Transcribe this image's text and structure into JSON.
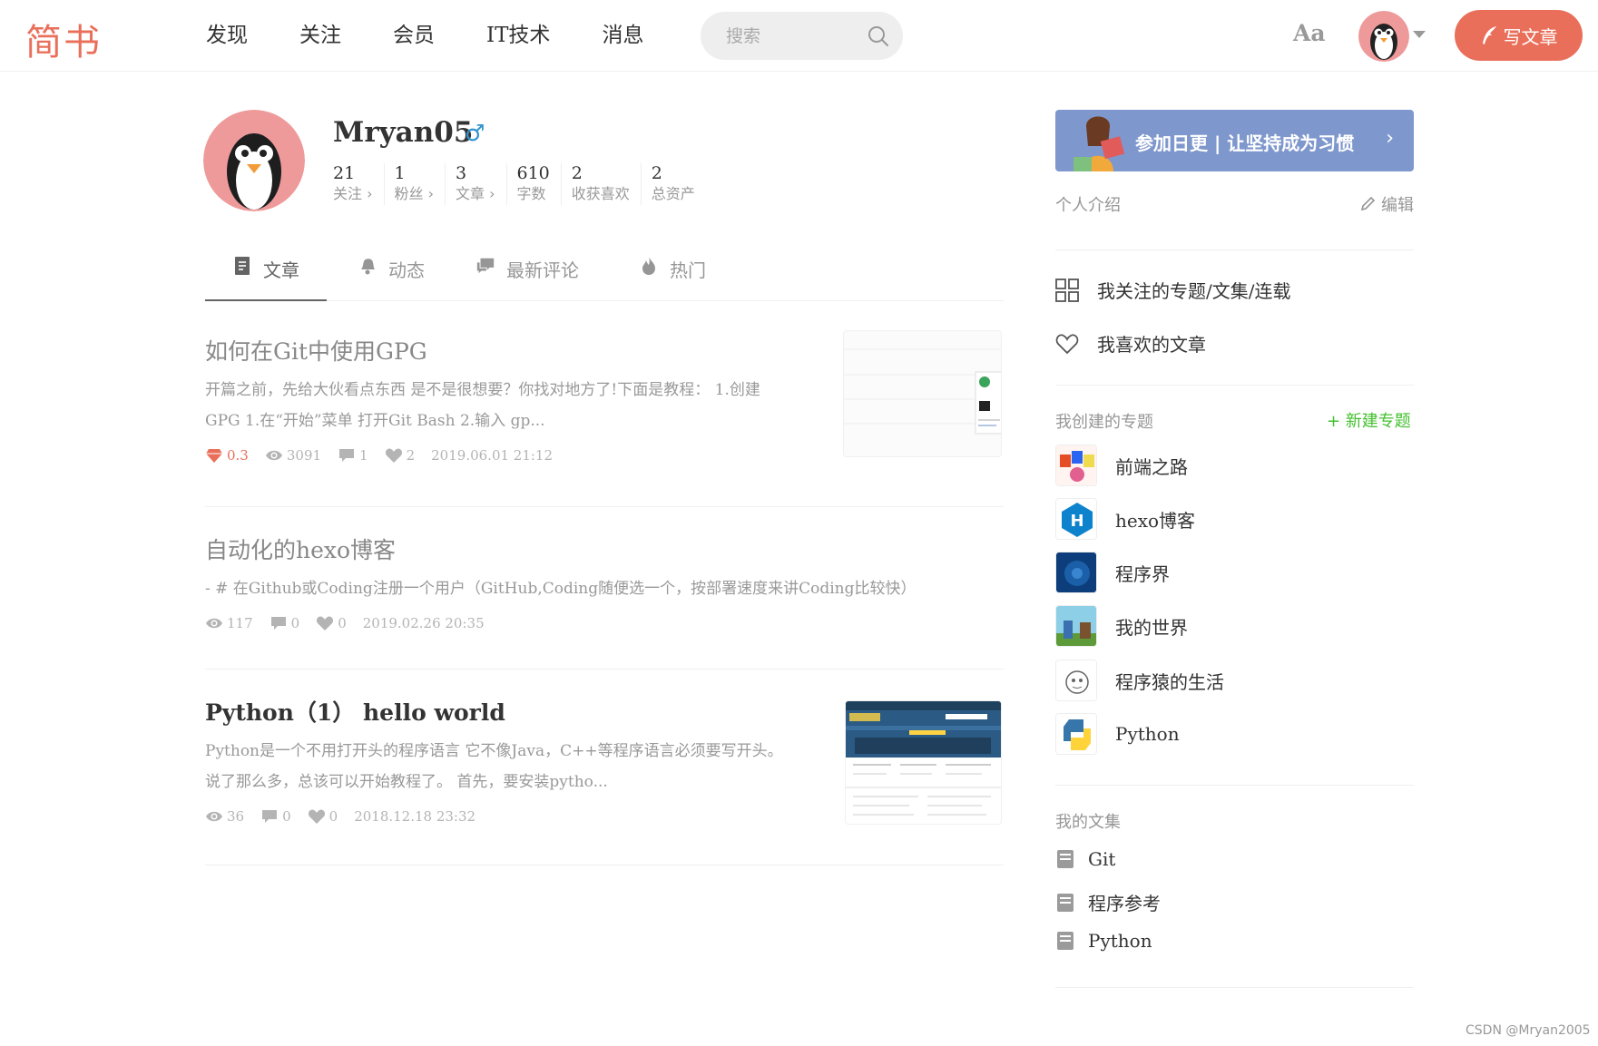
{
  "nav": {
    "logo": "简书",
    "links": [
      "发现",
      "关注",
      "会员",
      "IT技术",
      "消息"
    ],
    "search_placeholder": "搜索",
    "font_toggle": "Aa",
    "write_label": "写文章",
    "accent_color": "#ea6f5a"
  },
  "profile": {
    "username": "Mryan05",
    "gender_symbol": "♂",
    "stats": [
      {
        "value": "21",
        "label": "关注 ›"
      },
      {
        "value": "1",
        "label": "粉丝 ›"
      },
      {
        "value": "3",
        "label": "文章 ›"
      },
      {
        "value": "610",
        "label": "字数"
      },
      {
        "value": "2",
        "label": "收获喜欢"
      },
      {
        "value": "2",
        "label": "总资产"
      }
    ]
  },
  "tabs": [
    {
      "label": "文章",
      "icon": "document-icon",
      "active": true
    },
    {
      "label": "动态",
      "icon": "bell-icon",
      "active": false
    },
    {
      "label": "最新评论",
      "icon": "comment-icon",
      "active": false
    },
    {
      "label": "热门",
      "icon": "fire-icon",
      "active": false
    }
  ],
  "articles": [
    {
      "title": "如何在Git中使用GPG",
      "abstract_line1": "开篇之前，先给大伙看点东西 是不是很想要？你找对地方了!下面是教程：  1.创建",
      "abstract_line2": "GPG 1.在“开始”菜单 打开Git Bash 2.输入 gp...",
      "diamond": "0.3",
      "views": "3091",
      "comments": "1",
      "likes": "2",
      "date": "2019.06.01 21:12"
    },
    {
      "title": "自动化的hexo博客",
      "abstract_line1": "- # 在Github或Coding注册一个用户（GitHub,Coding随便选一个，按部署速度来讲Coding比较快）",
      "views": "117",
      "comments": "0",
      "likes": "0",
      "date": "2019.02.26 20:35"
    },
    {
      "title": "Python（1） hello world",
      "abstract_line1": "Python是一个不用打开头的程序语言 它不像Java，C++等程序语言必须要写开头。",
      "abstract_line2": "说了那么多，总该可以开始教程了。 首先，要安装pytho...",
      "views": "36",
      "comments": "0",
      "likes": "0",
      "date": "2018.12.18 23:32"
    }
  ],
  "sidebar": {
    "banner_text": "参加日更 | 让坚持成为习惯",
    "banner_arrow": "›",
    "intro_label": "个人介绍",
    "edit_label": "编辑",
    "followed_topics": "我关注的专题/文集/连载",
    "liked_articles": "我喜欢的文章",
    "my_topics_label": "我创建的专题",
    "new_topic_label": "+ 新建专题",
    "topics": [
      "前端之路",
      "hexo博客",
      "程序界",
      "我的世界",
      "程序猿的生活",
      "Python"
    ],
    "collections_label": "我的文集",
    "collections": [
      "Git",
      "程序参考",
      "Python"
    ]
  },
  "watermark": "CSDN @Mryan2005"
}
